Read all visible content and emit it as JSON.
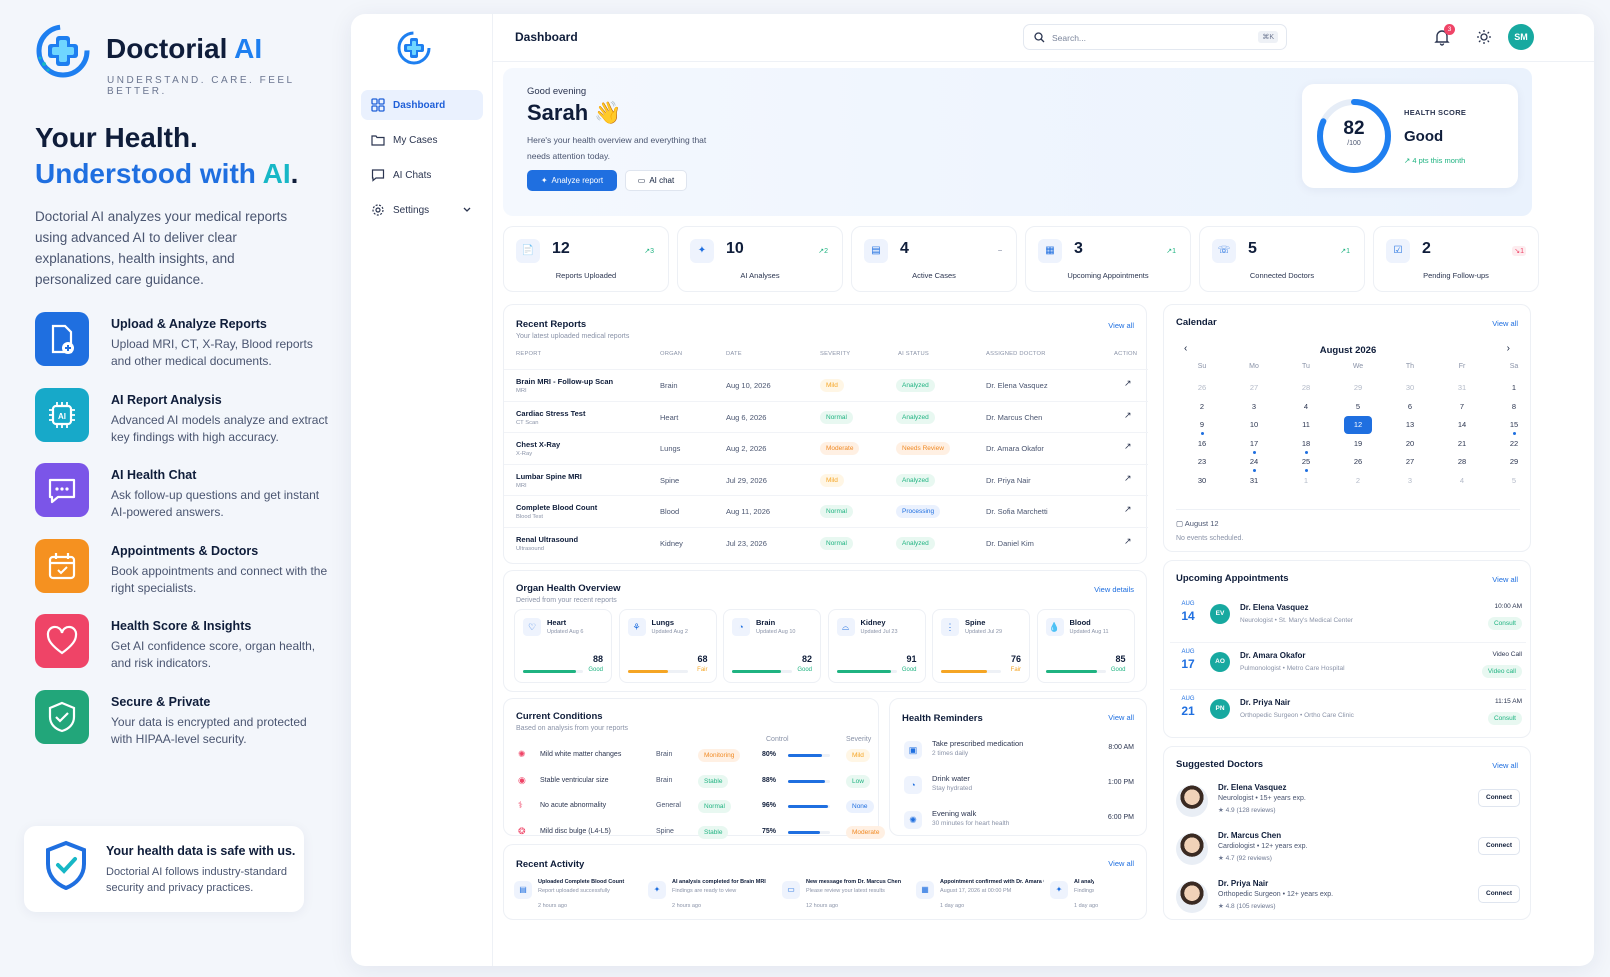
{
  "brand": {
    "name_main": "Doctorial",
    "name_ai": "AI",
    "tagline": "UNDERSTAND. CARE. FEEL BETTER."
  },
  "hero": {
    "line1": "Your Health.",
    "line2_a": "Understood with ",
    "line2_ai": "AI",
    "line2_end": ".",
    "intro": "Doctorial AI analyzes your medical reports using advanced AI to deliver clear explanations, health insights, and personalized care guidance."
  },
  "features": [
    {
      "title": "Upload & Analyze Reports",
      "desc": "Upload MRI, CT, X-Ray, Blood reports and other medical documents.",
      "icon": "upload-report-icon",
      "color": "#1f6fe0"
    },
    {
      "title": "AI Report Analysis",
      "desc": "Advanced AI models analyze and extract key findings with high accuracy.",
      "icon": "ai-chip-icon",
      "color": "#17a9c9"
    },
    {
      "title": "AI Health Chat",
      "desc": "Ask follow-up questions and get instant AI-powered answers.",
      "icon": "chat-icon",
      "color": "#7b55e8"
    },
    {
      "title": "Appointments & Doctors",
      "desc": "Book appointments and connect with the right specialists.",
      "icon": "calendar-icon",
      "color": "#f59120"
    },
    {
      "title": "Health Score & Insights",
      "desc": "Get AI confidence score, organ health, and risk indicators.",
      "icon": "heart-icon",
      "color": "#ef4467"
    },
    {
      "title": "Secure & Private",
      "desc": "Your data is encrypted and protected with HIPAA-level security.",
      "icon": "shield-icon",
      "color": "#22a67a"
    }
  ],
  "safe": {
    "title": "Your health data is safe with us.",
    "desc": "Doctorial AI follows industry-standard security and privacy practices."
  },
  "nav": [
    {
      "label": "Dashboard"
    },
    {
      "label": "My Cases"
    },
    {
      "label": "AI Chats"
    },
    {
      "label": "Settings"
    }
  ],
  "topbar": {
    "title": "Dashboard",
    "search_placeholder": "Search...",
    "shortcut": "⌘K",
    "notif_count": "3",
    "avatar": "SM"
  },
  "greeting": {
    "hello": "Good evening",
    "name": "Sarah",
    "wave": "👋",
    "sub": "Here's your health overview and everything that needs attention today.",
    "btn_analyze": "Analyze report",
    "btn_chat": "AI chat"
  },
  "score": {
    "value": 82,
    "max": "/100",
    "label": "HEALTH SCORE",
    "status": "Good",
    "delta": "4 pts this month"
  },
  "stats": [
    {
      "value": "12",
      "label": "Reports Uploaded",
      "delta": "3",
      "trend": "up"
    },
    {
      "value": "10",
      "label": "AI Analyses",
      "delta": "2",
      "trend": "up"
    },
    {
      "value": "4",
      "label": "Active Cases",
      "delta": "–",
      "trend": "flat"
    },
    {
      "value": "3",
      "label": "Upcoming Appointments",
      "delta": "1",
      "trend": "up"
    },
    {
      "value": "5",
      "label": "Connected Doctors",
      "delta": "1",
      "trend": "up"
    },
    {
      "value": "2",
      "label": "Pending Follow-ups",
      "delta": "1",
      "trend": "down"
    }
  ],
  "reports": {
    "title": "Recent Reports",
    "sub": "Your latest uploaded medical reports",
    "view_all": "View all",
    "headers": [
      "REPORT",
      "ORGAN",
      "DATE",
      "SEVERITY",
      "AI STATUS",
      "ASSIGNED DOCTOR",
      "ACTION"
    ],
    "rows": [
      {
        "name": "Brain MRI - Follow-up Scan",
        "type": "MRI",
        "organ": "Brain",
        "date": "Aug 10, 2026",
        "severity": "Mild",
        "status": "Analyzed",
        "doctor": "Dr. Elena Vasquez"
      },
      {
        "name": "Cardiac Stress Test",
        "type": "CT Scan",
        "organ": "Heart",
        "date": "Aug 6, 2026",
        "severity": "Normal",
        "status": "Analyzed",
        "doctor": "Dr. Marcus Chen"
      },
      {
        "name": "Chest X-Ray",
        "type": "X-Ray",
        "organ": "Lungs",
        "date": "Aug 2, 2026",
        "severity": "Moderate",
        "status": "Needs Review",
        "doctor": "Dr. Amara Okafor"
      },
      {
        "name": "Lumbar Spine MRI",
        "type": "MRI",
        "organ": "Spine",
        "date": "Jul 29, 2026",
        "severity": "Mild",
        "status": "Analyzed",
        "doctor": "Dr. Priya Nair"
      },
      {
        "name": "Complete Blood Count",
        "type": "Blood Test",
        "organ": "Blood",
        "date": "Aug 11, 2026",
        "severity": "Normal",
        "status": "Processing",
        "doctor": "Dr. Sofia Marchetti"
      },
      {
        "name": "Renal Ultrasound",
        "type": "Ultrasound",
        "organ": "Kidney",
        "date": "Jul 23, 2026",
        "severity": "Normal",
        "status": "Analyzed",
        "doctor": "Dr. Daniel Kim"
      }
    ]
  },
  "organs": {
    "title": "Organ Health Overview",
    "sub": "Derived from your recent reports",
    "view": "View details",
    "items": [
      {
        "name": "Heart",
        "updated": "Updated Aug 6",
        "score": 88,
        "status": "Good"
      },
      {
        "name": "Lungs",
        "updated": "Updated Aug 2",
        "score": 68,
        "status": "Fair"
      },
      {
        "name": "Brain",
        "updated": "Updated Aug 10",
        "score": 82,
        "status": "Good"
      },
      {
        "name": "Kidney",
        "updated": "Updated Jul 23",
        "score": 91,
        "status": "Good"
      },
      {
        "name": "Spine",
        "updated": "Updated Jul 29",
        "score": 76,
        "status": "Fair"
      },
      {
        "name": "Blood",
        "updated": "Updated Aug 11",
        "score": 85,
        "status": "Good"
      }
    ]
  },
  "conditions": {
    "title": "Current Conditions",
    "sub": "Based on analysis from your reports",
    "col_control": "Control",
    "col_severity": "Severity",
    "rows": [
      {
        "name": "Mild white matter changes",
        "organ": "Brain",
        "status": "Monitoring",
        "control": "80%",
        "severity": "Mild"
      },
      {
        "name": "Stable ventricular size",
        "organ": "Brain",
        "status": "Stable",
        "control": "88%",
        "severity": "Low"
      },
      {
        "name": "No acute abnormality",
        "organ": "General",
        "status": "Normal",
        "control": "96%",
        "severity": "None"
      },
      {
        "name": "Mild disc bulge (L4-L5)",
        "organ": "Spine",
        "status": "Stable",
        "control": "75%",
        "severity": "Moderate"
      }
    ]
  },
  "reminders": {
    "title": "Health Reminders",
    "view_all": "View all",
    "items": [
      {
        "title": "Take prescribed medication",
        "sub": "2 times daily",
        "time": "8:00 AM"
      },
      {
        "title": "Drink water",
        "sub": "Stay hydrated",
        "time": "1:00 PM"
      },
      {
        "title": "Evening walk",
        "sub": "30 minutes for heart health",
        "time": "6:00 PM"
      }
    ]
  },
  "activity": {
    "title": "Recent Activity",
    "view_all": "View all",
    "items": [
      {
        "title": "Uploaded Complete Blood Count",
        "sub": "Report uploaded successfully",
        "time": "2 hours ago"
      },
      {
        "title": "AI analysis completed for Brain MRI",
        "sub": "Findings are ready to view",
        "time": "2 hours ago"
      },
      {
        "title": "New message from Dr. Marcus Chen",
        "sub": "Please review your latest results",
        "time": "12 hours ago"
      },
      {
        "title": "Appointment confirmed with Dr. Amara Okafor",
        "sub": "August 17, 2026 at 00:00 PM",
        "time": "1 day ago"
      },
      {
        "title": "AI analysis in...",
        "sub": "Findings...",
        "time": "1 day ago"
      }
    ]
  },
  "calendar": {
    "title": "Calendar",
    "view_all": "View all",
    "month": "August 2026",
    "days": [
      "Su",
      "Mo",
      "Tu",
      "We",
      "Th",
      "Fr",
      "Sa"
    ],
    "cells": [
      "26",
      "27",
      "28",
      "29",
      "30",
      "31",
      "1",
      "2",
      "3",
      "4",
      "5",
      "6",
      "7",
      "8",
      "9",
      "10",
      "11",
      "12",
      "13",
      "14",
      "15",
      "16",
      "17",
      "18",
      "19",
      "20",
      "21",
      "22",
      "23",
      "24",
      "25",
      "26",
      "27",
      "28",
      "29",
      "30",
      "31",
      "1",
      "2",
      "3",
      "4",
      "5"
    ],
    "selected_index": 17,
    "muted_before": 6,
    "muted_after_index": 37,
    "dotted_indices": [
      14,
      20,
      22,
      23,
      29,
      30
    ],
    "event_date": "August 12",
    "event_note": "No events scheduled."
  },
  "appointments": {
    "title": "Upcoming Appointments",
    "view_all": "View all",
    "items": [
      {
        "month": "AUG",
        "day": "14",
        "initials": "EV",
        "name": "Dr. Elena Vasquez",
        "sub": "Neurologist • St. Mary's Medical Center",
        "time": "10:00 AM",
        "tag": "Consult"
      },
      {
        "month": "AUG",
        "day": "17",
        "initials": "AO",
        "name": "Dr. Amara Okafor",
        "sub": "Pulmonologist • Metro Care Hospital",
        "time": "Video Call",
        "tag": "Video call"
      },
      {
        "month": "AUG",
        "day": "21",
        "initials": "PN",
        "name": "Dr. Priya Nair",
        "sub": "Orthopedic Surgeon • Ortho Care Clinic",
        "time": "11:15 AM",
        "tag": "Consult"
      }
    ]
  },
  "doctors": {
    "title": "Suggested Doctors",
    "view_all": "View all",
    "btn": "Connect",
    "items": [
      {
        "name": "Dr. Elena Vasquez",
        "spec": "Neurologist • 15+ years exp.",
        "rating": "★ 4.9 (128 reviews)"
      },
      {
        "name": "Dr. Marcus Chen",
        "spec": "Cardiologist • 12+ years exp.",
        "rating": "★ 4.7 (92 reviews)"
      },
      {
        "name": "Dr. Priya Nair",
        "spec": "Orthopedic Surgeon • 12+ years exp.",
        "rating": "★ 4.8 (105 reviews)"
      }
    ]
  },
  "colors": {
    "primary": "#1f6fe0",
    "teal": "#17b7c6",
    "good": "#1fb381",
    "fair": "#f5a524",
    "danger": "#ef4467"
  }
}
